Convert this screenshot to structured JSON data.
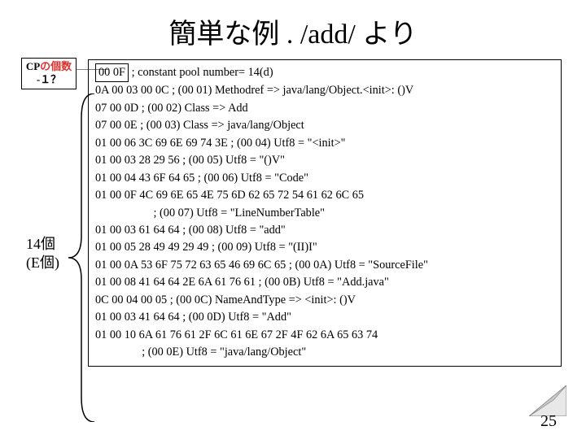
{
  "title": "簡単な例 . /add/ より",
  "cp_box": {
    "line1_pre": "CP",
    "line1_hl": "の個数",
    "line2": "-１？"
  },
  "brace_label": {
    "line1": "14個",
    "line2": "(E個)"
  },
  "first_bytes": "00 0F",
  "first_line_tail": "; constant pool number= 14(d)",
  "lines": [
    "0A 00 03 00 0C ; (00 01) Methodref => java/lang/Object.<init>: ()V",
    "07 00 0D ; (00 02) Class => Add",
    "07 00 0E ; (00 03) Class => java/lang/Object",
    "01 00 06 3C 69 6E 69 74 3E ; (00 04) Utf8 = \"<init>\"",
    "01 00 03 28 29 56 ; (00 05) Utf8 = \"()V\"",
    "01 00 04 43 6F 64 65 ; (00 06) Utf8 = \"Code\"",
    "01 00 0F 4C 69 6E 65 4E 75 6D 62 65 72 54 61 62 6C 65",
    "                    ; (00 07) Utf8 = \"LineNumberTable\"",
    "01 00 03 61 64 64 ; (00 08) Utf8 = \"add\"",
    "01 00 05 28 49 49 29 49 ; (00 09) Utf8 = \"(II)I\"",
    "01 00 0A 53 6F 75 72 63 65 46 69 6C 65 ; (00 0A) Utf8 = \"SourceFile\"",
    "01 00 08 41 64 64 2E 6A 61 76 61 ; (00 0B) Utf8 = \"Add.java\"",
    "0C 00 04 00 05 ; (00 0C) NameAndType => <init>: ()V",
    "01 00 03 41 64 64 ; (00 0D) Utf8 = \"Add\"",
    "01 00 10 6A 61 76 61 2F 6C 61 6E 67 2F 4F 62 6A 65 63 74",
    "                ; (00 0E) Utf8 = \"java/lang/Object\""
  ],
  "page_number": "25"
}
